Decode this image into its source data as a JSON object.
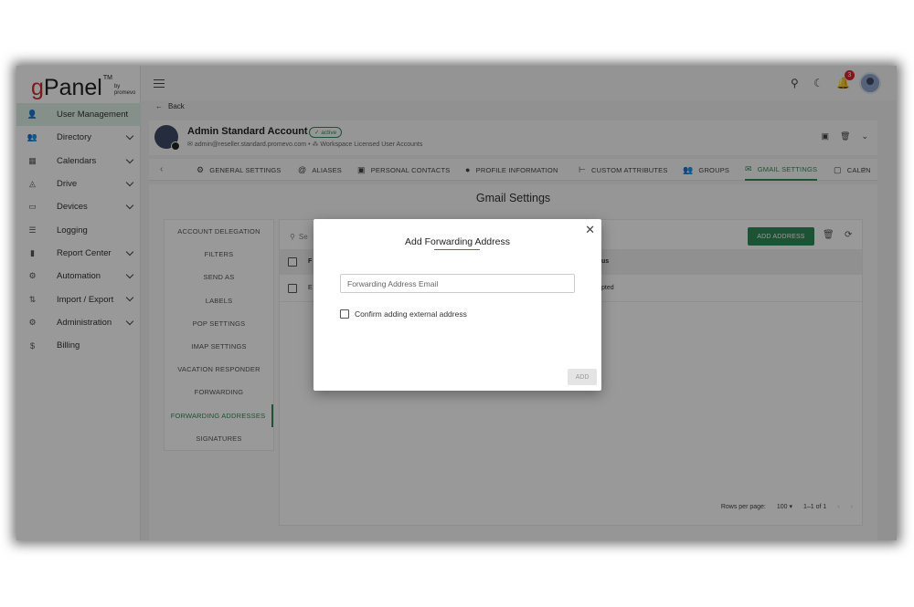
{
  "logo": {
    "g": "g",
    "rest": "Panel",
    "tm": "TM",
    "by": "by promevo"
  },
  "sidebar": {
    "items": [
      {
        "label": "User Management",
        "icon": "person-icon",
        "glyph": "👤",
        "active": true,
        "chevron": false
      },
      {
        "label": "Directory",
        "icon": "people-icon",
        "glyph": "👥",
        "chevron": true
      },
      {
        "label": "Calendars",
        "icon": "calendar-icon",
        "glyph": "▦",
        "chevron": true
      },
      {
        "label": "Drive",
        "icon": "drive-icon",
        "glyph": "◬",
        "chevron": true
      },
      {
        "label": "Devices",
        "icon": "devices-icon",
        "glyph": "▭",
        "chevron": true
      },
      {
        "label": "Logging",
        "icon": "list-icon",
        "glyph": "☰",
        "chevron": false
      },
      {
        "label": "Report Center",
        "icon": "chart-icon",
        "glyph": "▮",
        "chevron": true
      },
      {
        "label": "Automation",
        "icon": "gears-icon",
        "glyph": "⚙",
        "chevron": true
      },
      {
        "label": "Import / Export",
        "icon": "swap-icon",
        "glyph": "⇅",
        "chevron": true
      },
      {
        "label": "Administration",
        "icon": "admin-gears-icon",
        "glyph": "⚙",
        "chevron": true
      },
      {
        "label": "Billing",
        "icon": "dollar-icon",
        "glyph": "$",
        "chevron": false
      }
    ]
  },
  "topbar": {
    "notification_count": "3"
  },
  "back_label": "Back",
  "account": {
    "name": "Admin Standard Account",
    "status": "✓ active",
    "email": "admin@reseller.standard.promevo.com",
    "org": "Workspace Licensed User Accounts"
  },
  "tabs": [
    {
      "label": "GENERAL SETTINGS",
      "icon": "gear-icon",
      "glyph": "⚙"
    },
    {
      "label": "ALIASES",
      "icon": "at-icon",
      "glyph": "@"
    },
    {
      "label": "PERSONAL CONTACTS",
      "icon": "contacts-icon",
      "glyph": "▣"
    },
    {
      "label": "PROFILE INFORMATION",
      "icon": "info-icon",
      "glyph": "●"
    },
    {
      "label": "CUSTOM ATTRIBUTES",
      "icon": "attributes-icon",
      "glyph": "⊢"
    },
    {
      "label": "GROUPS",
      "icon": "groups-icon",
      "glyph": "👥"
    },
    {
      "label": "GMAIL SETTINGS",
      "icon": "mail-icon",
      "glyph": "✉",
      "active": true
    },
    {
      "label": "CALEN",
      "icon": "calendar-tab-icon",
      "glyph": "▢"
    }
  ],
  "section_title": "Gmail Settings",
  "subnav": [
    {
      "label": "ACCOUNT DELEGATION"
    },
    {
      "label": "FILTERS"
    },
    {
      "label": "SEND AS"
    },
    {
      "label": "LABELS"
    },
    {
      "label": "POP SETTINGS"
    },
    {
      "label": "IMAP SETTINGS"
    },
    {
      "label": "VACATION RESPONDER"
    },
    {
      "label": "FORWARDING"
    },
    {
      "label": "FORWARDING ADDRESSES",
      "active": true
    },
    {
      "label": "SIGNATURES"
    }
  ],
  "panel": {
    "search_placeholder": "Se",
    "add_address_label": "ADD ADDRESS",
    "col_first_visible": "F",
    "col_status_visible": "us",
    "row1_first_visible": "E",
    "row1_status_visible": "pted",
    "rows_per_page_label": "Rows per page:",
    "rows_per_page_value": "100 ▾",
    "range": "1–1 of 1"
  },
  "modal": {
    "title": "Add Forwarding Address",
    "input_placeholder": "Forwarding Address Email",
    "checkbox_label": "Confirm adding external address",
    "add_label": "ADD",
    "close_glyph": "✕"
  },
  "colors": {
    "accent": "#2e8b57",
    "brand_red": "#d0282e",
    "active_bg": "#dff1e6"
  }
}
